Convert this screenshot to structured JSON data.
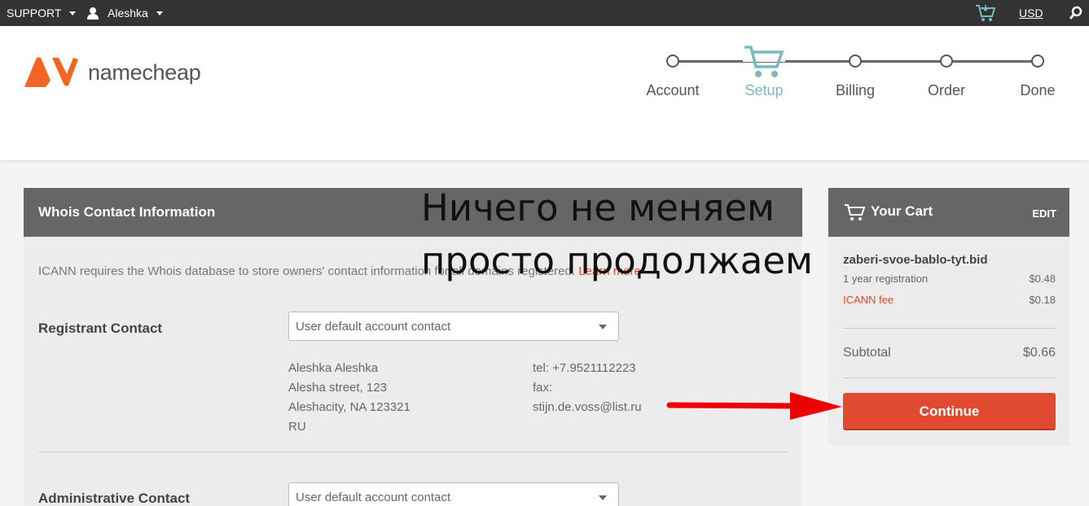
{
  "topbar": {
    "support_label": "SUPPORT",
    "user_name": "Aleshka",
    "currency": "USD"
  },
  "brand": {
    "name": "namecheap",
    "colors": {
      "orange": "#f26522",
      "accent": "#e04a30",
      "step_active": "#7ab8c0"
    }
  },
  "steps": [
    {
      "label": "Account",
      "state": "done"
    },
    {
      "label": "Setup",
      "state": "active"
    },
    {
      "label": "Billing",
      "state": "pending"
    },
    {
      "label": "Order",
      "state": "pending"
    },
    {
      "label": "Done",
      "state": "pending"
    }
  ],
  "whois": {
    "title": "Whois Contact Information",
    "note": "ICANN requires the Whois database to store owners' contact information for all domains registered.",
    "note_link": "Learn more →",
    "registrant": {
      "label": "Registrant Contact",
      "select_value": "User default account contact",
      "address": [
        "Aleshka Aleshka",
        "Alesha street, 123",
        "Aleshacity, NA 123321",
        "RU"
      ],
      "contact": [
        "tel: +7.9521112223",
        "fax:",
        "stijn.de.voss@list.ru"
      ]
    },
    "administrative": {
      "label": "Administrative Contact",
      "select_value": "User default account contact"
    }
  },
  "cart": {
    "title": "Your Cart",
    "edit_label": "EDIT",
    "domain": "zaberi-svoe-bablo-tyt.bid",
    "registration_label": "1 year registration",
    "registration_price": "$0.48",
    "icann_label": "ICANN fee",
    "icann_price": "$0.18",
    "subtotal_label": "Subtotal",
    "subtotal_value": "$0.66",
    "continue_label": "Continue"
  },
  "annotation": {
    "line1": "Ничего не меняем",
    "line2": "просто продолжаем"
  }
}
